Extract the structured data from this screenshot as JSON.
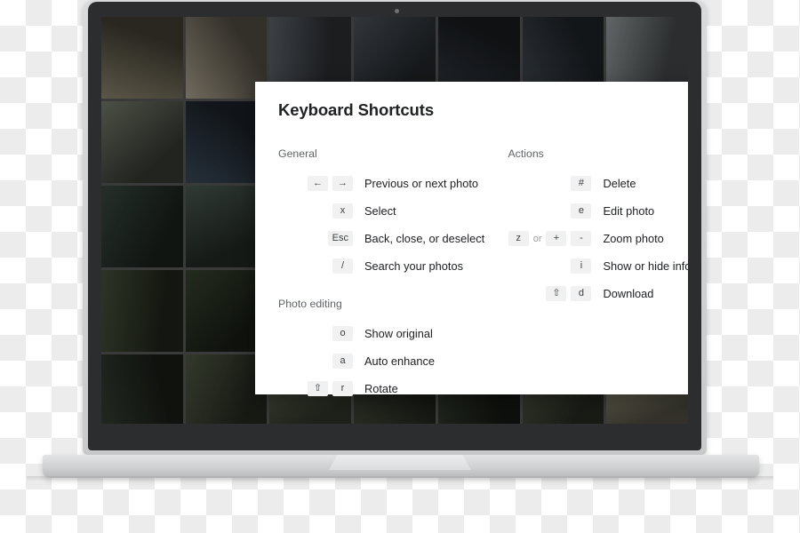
{
  "dialog": {
    "title": "Keyboard Shortcuts",
    "close_icon": "close-icon",
    "columns": {
      "left": [
        {
          "section": "General",
          "items": [
            {
              "keys": [
                "←",
                "→"
              ],
              "separator": "",
              "description": "Previous or next photo"
            },
            {
              "keys": [
                "x"
              ],
              "separator": "",
              "description": "Select"
            },
            {
              "keys": [
                "Esc"
              ],
              "separator": "",
              "description": "Back, close, or deselect"
            },
            {
              "keys": [
                "/"
              ],
              "separator": "",
              "description": "Search your photos"
            }
          ]
        },
        {
          "section": "Photo editing",
          "items": [
            {
              "keys": [
                "o"
              ],
              "separator": "",
              "description": "Show original"
            },
            {
              "keys": [
                "a"
              ],
              "separator": "",
              "description": "Auto enhance"
            },
            {
              "keys": [
                "⇧",
                "r"
              ],
              "separator": "",
              "description": "Rotate"
            }
          ]
        }
      ],
      "right": [
        {
          "section": "Actions",
          "items": [
            {
              "keys": [
                "#"
              ],
              "separator": "",
              "description": "Delete"
            },
            {
              "keys": [
                "e"
              ],
              "separator": "",
              "description": "Edit photo"
            },
            {
              "keys": [
                "z",
                "+",
                "-"
              ],
              "separator": "or",
              "description": "Zoom photo"
            },
            {
              "keys": [
                "i"
              ],
              "separator": "",
              "description": "Show or hide info"
            },
            {
              "keys": [
                "⇧",
                "d"
              ],
              "separator": "",
              "description": "Download"
            }
          ]
        }
      ]
    }
  },
  "colors": {
    "dialog_background": "#ffffff",
    "title_text": "#202124",
    "section_text": "#5f6368",
    "key_chip_background": "#f1f1f1",
    "key_chip_text": "#3c4043",
    "laptop_bezel": "#2c2d2f",
    "laptop_frame": "#d9dadc",
    "laptop_base": "#cfd0d2"
  },
  "wallpaper": {
    "description": "photo-grid",
    "tiles": [
      "#6f6a58",
      "#8a8272",
      "#4a4f55",
      "#3c4248",
      "#2a2f35",
      "#343b42",
      "#767c7e",
      "#5d6356",
      "#2f3a46",
      "#1e2832",
      "#272f36",
      "#3a444d",
      "#2b333b",
      "#454b50",
      "#2e3a33",
      "#3b4740",
      "#252d25",
      "#1b2026",
      "#20262c",
      "#2a323a",
      "#9a9c9e",
      "#38402f",
      "#2c3526",
      "#1e251d",
      "#353c30",
      "#4a5142",
      "#5b6150",
      "#6e7364",
      "#2b3228",
      "#3f4636",
      "#545b48",
      "#33392c",
      "#262c22",
      "#44493a",
      "#8e8a74"
    ]
  }
}
